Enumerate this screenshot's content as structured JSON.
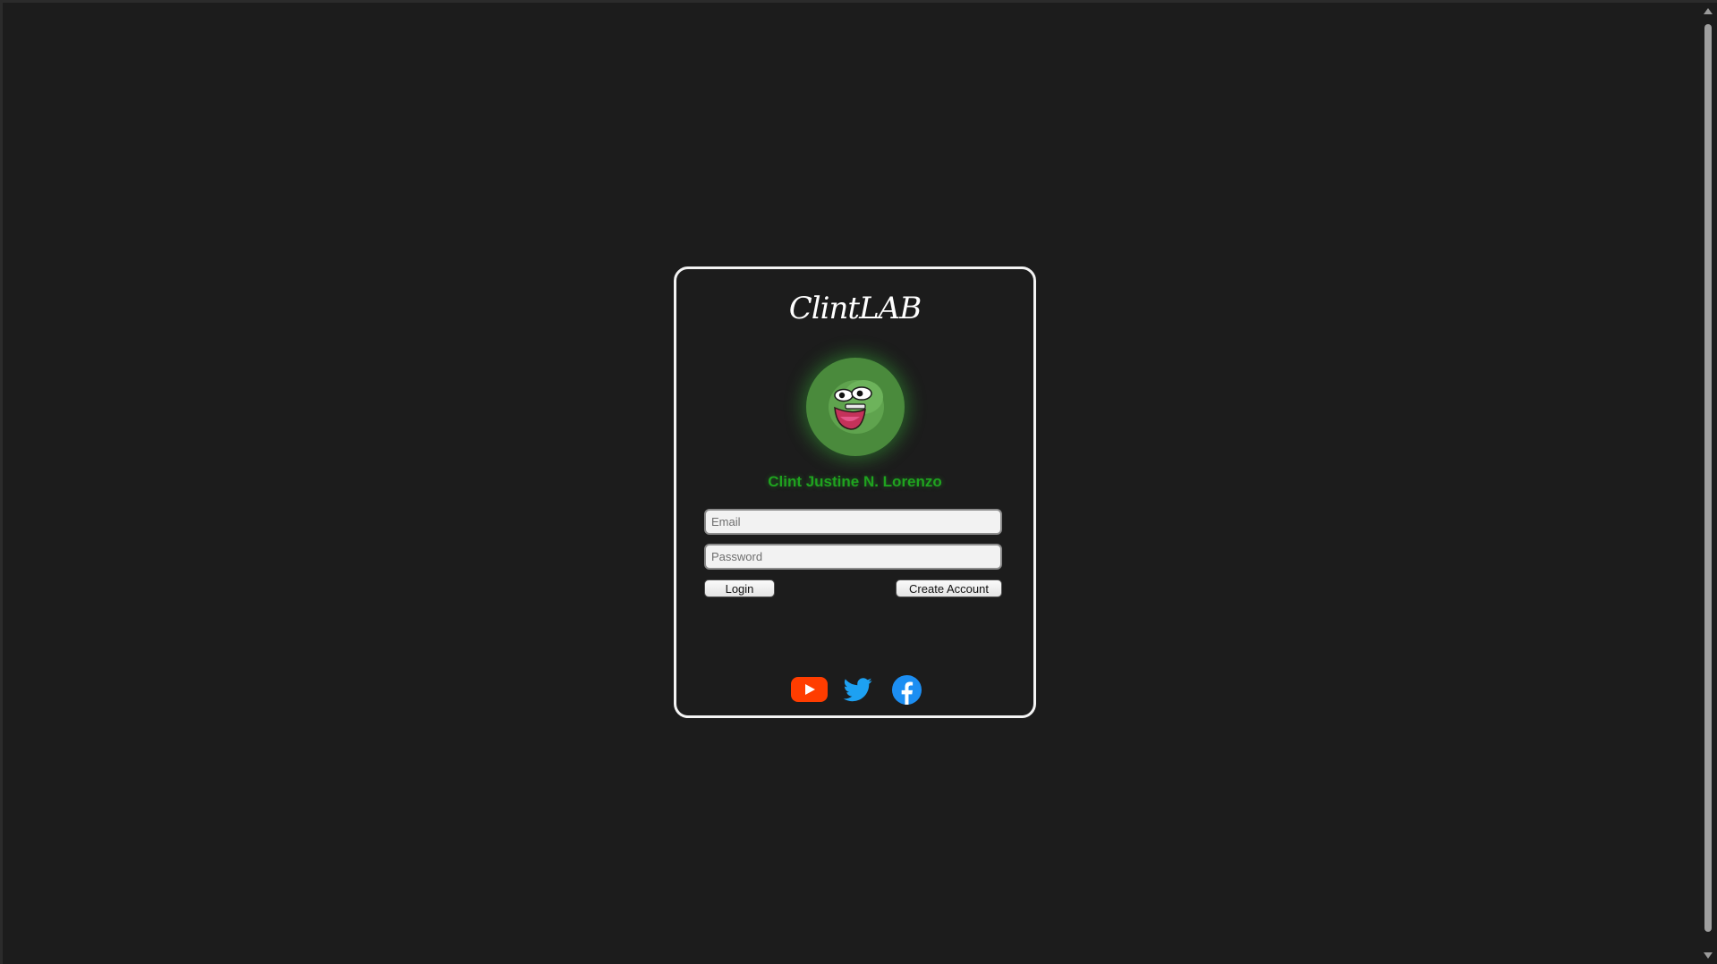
{
  "brand": {
    "title": "ClintLAB"
  },
  "profile": {
    "name": "Clint Justine N. Lorenzo",
    "avatar_icon": "frog-face-icon"
  },
  "form": {
    "email_placeholder": "Email",
    "email_value": "",
    "password_placeholder": "Password",
    "password_value": "",
    "login_label": "Login",
    "create_account_label": "Create Account"
  },
  "social": {
    "youtube_icon": "youtube-icon",
    "twitter_icon": "twitter-icon",
    "facebook_icon": "facebook-icon"
  },
  "colors": {
    "background": "#1c1c1c",
    "card_border": "#f4f4f4",
    "name_green": "#1fa31f",
    "avatar_green": "#4a8a3c",
    "youtube_red": "#ff3d00",
    "twitter_blue": "#1da1f2",
    "facebook_blue": "#1877f2"
  }
}
